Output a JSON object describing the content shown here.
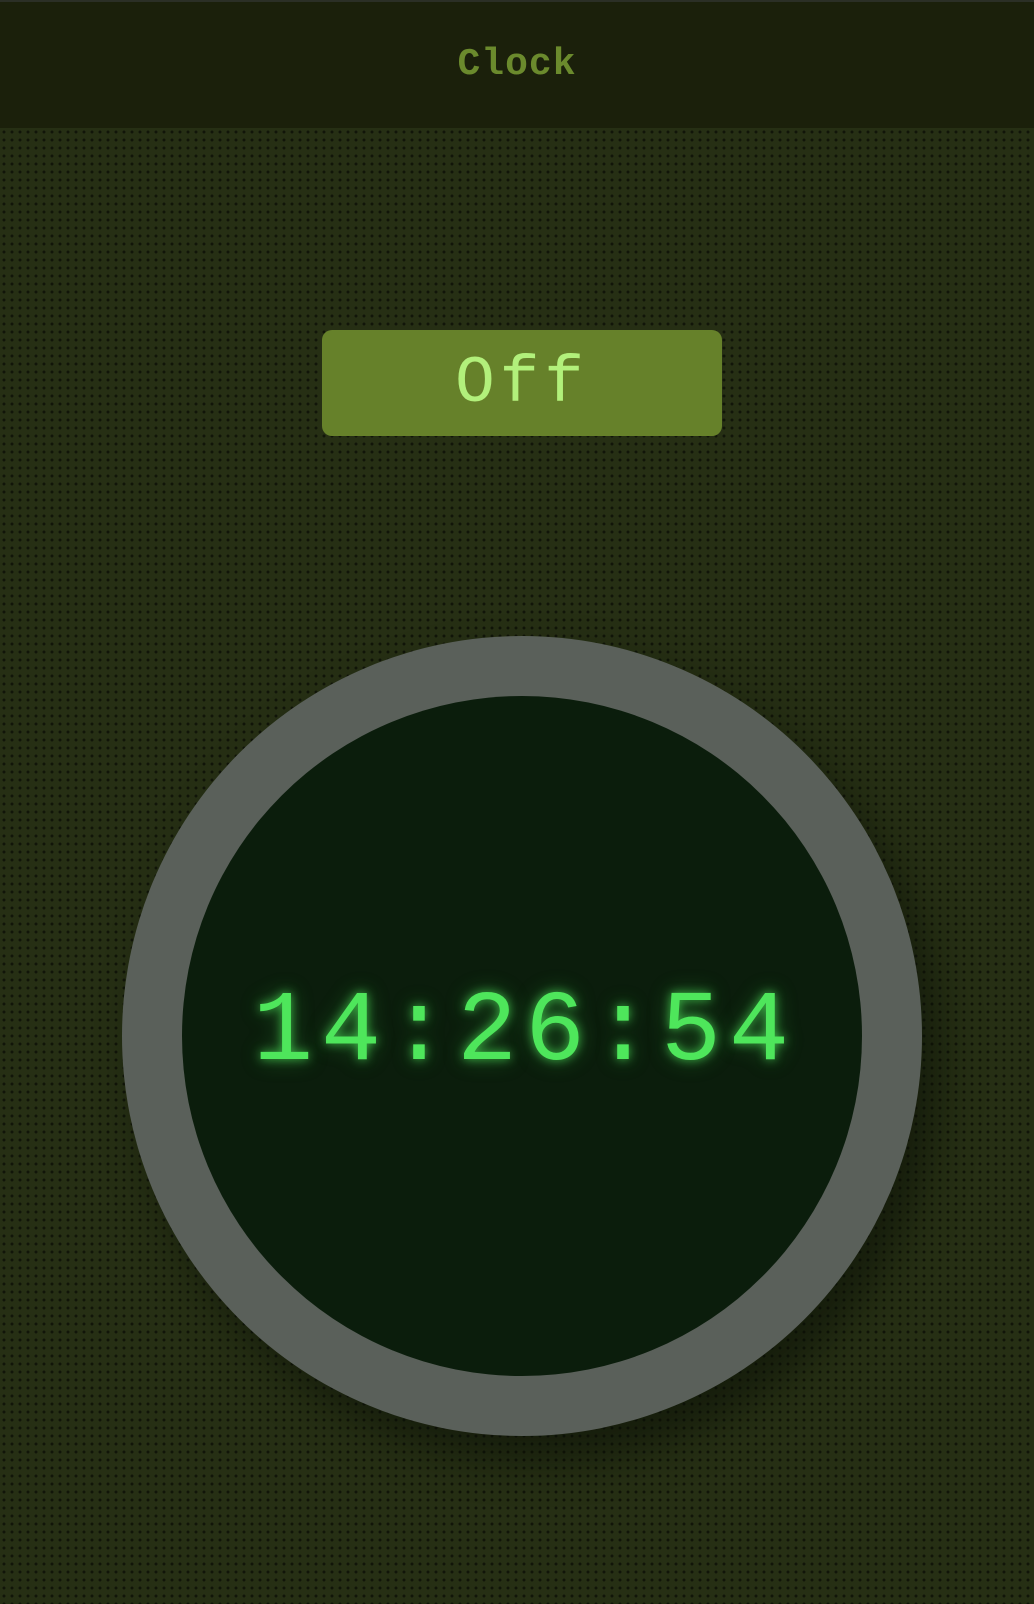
{
  "header": {
    "title": "Clock"
  },
  "toggle": {
    "label": "Off"
  },
  "clock": {
    "time": "14:26:54"
  },
  "colors": {
    "background": "#262f14",
    "header_background": "#1b200b",
    "header_text": "#6b8a2d",
    "button_background": "#66812a",
    "button_text": "#b2f07b",
    "ring": "#5a605a",
    "face": "#0b1d0c",
    "digits": "#4ee65b"
  }
}
